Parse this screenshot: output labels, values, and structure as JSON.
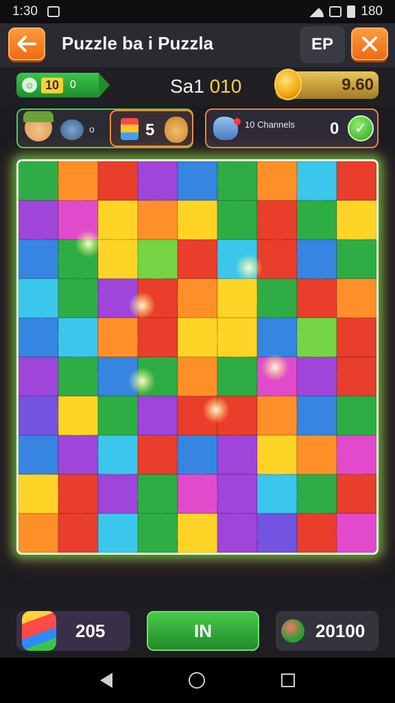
{
  "status_bar": {
    "time": "1:30",
    "battery_text": "180"
  },
  "header": {
    "title": "Puzzle ba i Puzzla",
    "ep_label": "EP"
  },
  "score_row": {
    "level": "10",
    "small": "0",
    "score_prefix": "Sa1",
    "score_value": "010",
    "coins": "9.60"
  },
  "stats": {
    "count_o": "o",
    "five": "5",
    "channels_label": "10 Channels",
    "channels_value": "0"
  },
  "bottom": {
    "left_value": "205",
    "mid_label": "IN",
    "right_value": "20100"
  },
  "icons": [
    "back-arrow-icon",
    "close-icon",
    "coin-icon",
    "check-icon",
    "bag-icon",
    "gem-icon"
  ],
  "colors": {
    "accent_orange": "#f06a12",
    "accent_green": "#2aa52a",
    "gold": "#ffd23a"
  },
  "board": {
    "cols": 9,
    "rows": 10,
    "palette": {
      "G": "#22a83a",
      "O": "#ff8a1c",
      "R": "#e8321e",
      "P": "#9a3ad8",
      "B": "#2a7ee0",
      "C": "#2fc4ea",
      "Y": "#ffd21a",
      "M": "#e040c8",
      "L": "#6fd23a",
      "V": "#6a4ae0"
    },
    "grid": [
      [
        "G",
        "O",
        "R",
        "P",
        "B",
        "G",
        "O",
        "C",
        "R"
      ],
      [
        "P",
        "M",
        "Y",
        "O",
        "Y",
        "G",
        "R",
        "G",
        "Y"
      ],
      [
        "B",
        "G",
        "Y",
        "L",
        "R",
        "C",
        "R",
        "B",
        "G"
      ],
      [
        "C",
        "G",
        "P",
        "R",
        "O",
        "Y",
        "G",
        "R",
        "O"
      ],
      [
        "B",
        "C",
        "O",
        "R",
        "Y",
        "Y",
        "B",
        "L",
        "R"
      ],
      [
        "P",
        "G",
        "B",
        "G",
        "O",
        "G",
        "M",
        "P",
        "R"
      ],
      [
        "V",
        "Y",
        "G",
        "P",
        "R",
        "R",
        "O",
        "B",
        "G"
      ],
      [
        "B",
        "P",
        "C",
        "R",
        "B",
        "P",
        "Y",
        "O",
        "M"
      ],
      [
        "Y",
        "R",
        "P",
        "G",
        "M",
        "P",
        "C",
        "G",
        "R"
      ],
      [
        "O",
        "R",
        "C",
        "G",
        "Y",
        "P",
        "V",
        "R",
        "M"
      ]
    ]
  }
}
